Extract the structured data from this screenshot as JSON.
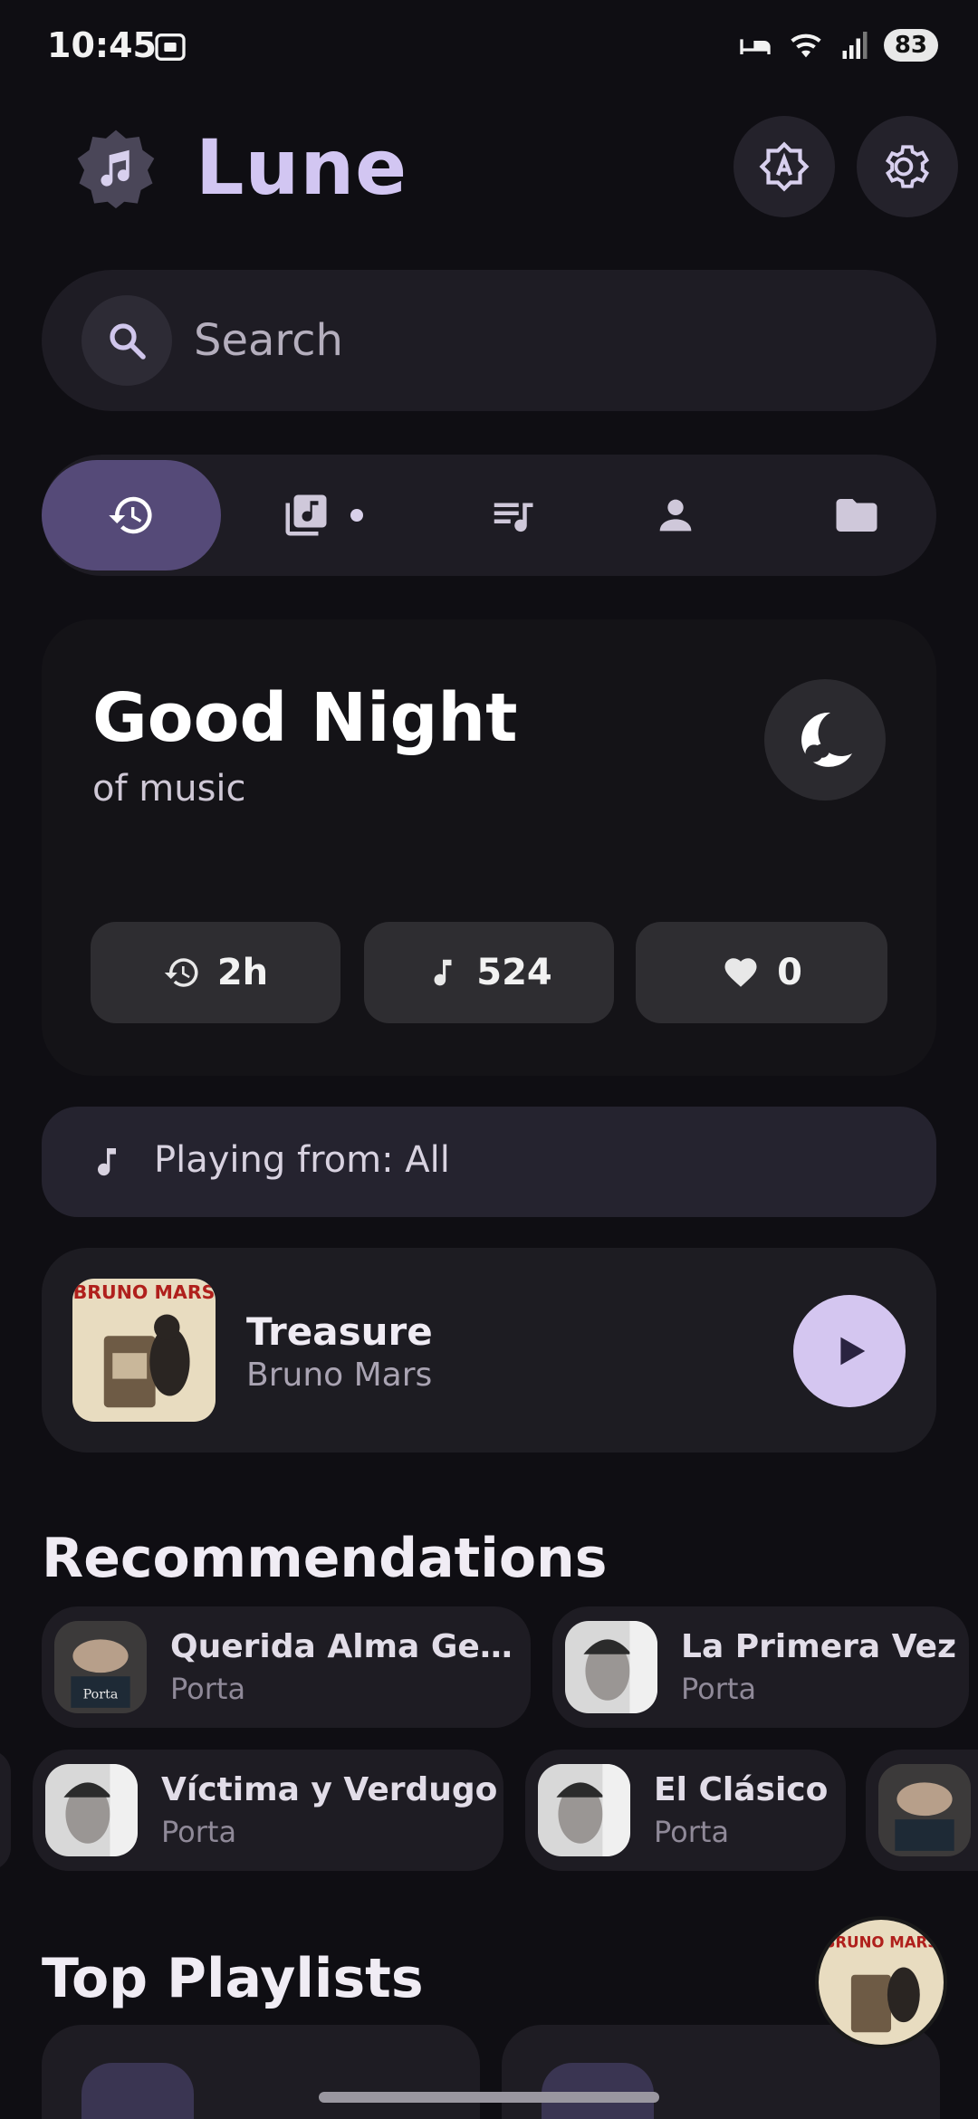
{
  "status_bar": {
    "time": "10:45",
    "battery": "83"
  },
  "header": {
    "title": "Lune"
  },
  "search": {
    "placeholder": "Search"
  },
  "greeting": {
    "title": "Good Night",
    "subtitle": "of music"
  },
  "stats": [
    {
      "icon": "history-icon",
      "value": "2h"
    },
    {
      "icon": "music-note-icon",
      "value": "524"
    },
    {
      "icon": "heart-icon",
      "value": "0"
    }
  ],
  "playing_from": "Playing from: All",
  "now_playing": {
    "title": "Treasure",
    "artist": "Bruno Mars"
  },
  "recommendations": {
    "title": "Recommendations",
    "row1": [
      {
        "title": "Querida Alma Ge…",
        "artist": "Porta"
      },
      {
        "title": "La Primera Vez",
        "artist": "Porta"
      }
    ],
    "row2": [
      {
        "title": "Víctima y Verdugo",
        "artist": "Porta"
      },
      {
        "title": "El Clásico",
        "artist": "Porta"
      }
    ]
  },
  "playlists": {
    "title": "Top Playlists"
  },
  "colors": {
    "accent": "#d4c6f0",
    "active_tab": "#554a78",
    "background": "#0f0e13"
  }
}
